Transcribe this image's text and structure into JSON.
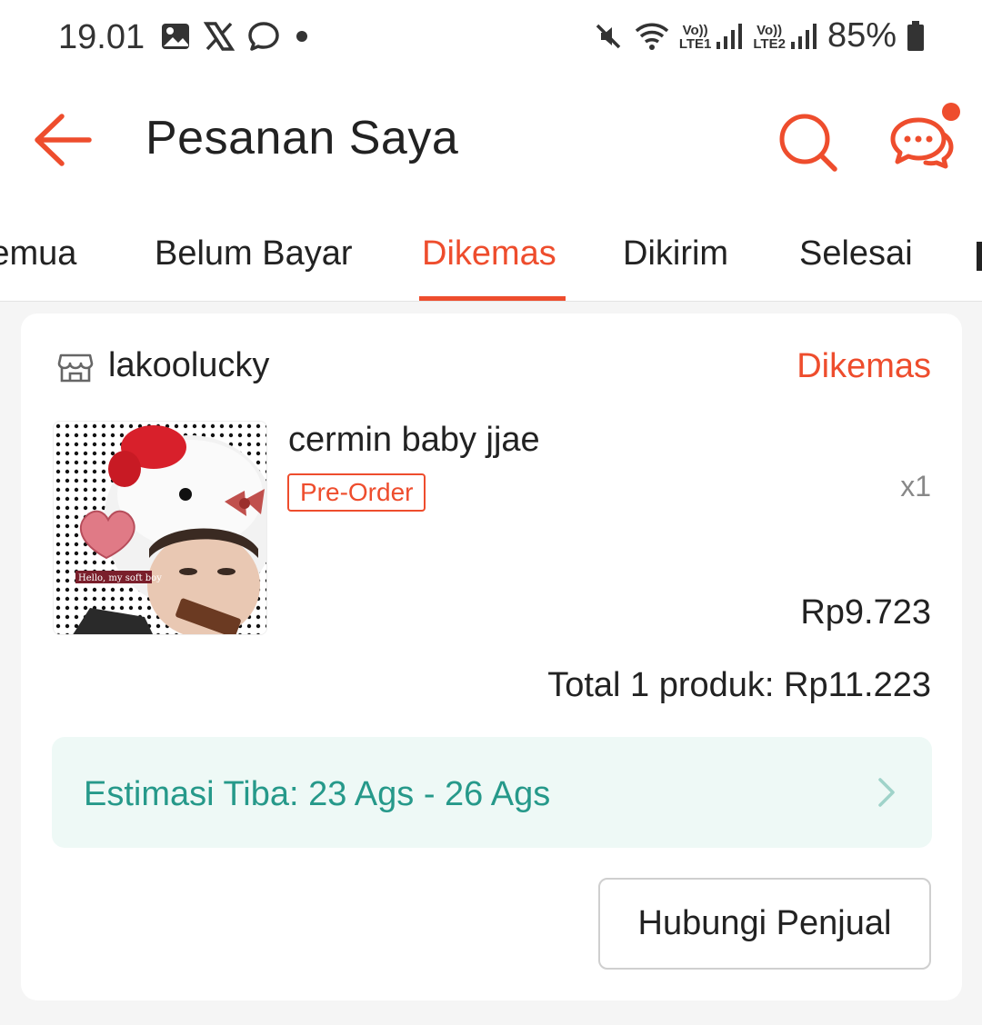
{
  "status_bar": {
    "time": "19.01",
    "battery": "85%",
    "sim1_label_top": "Vo))",
    "sim1_label_bottom": "LTE1",
    "sim2_label_top": "Vo))",
    "sim2_label_bottom": "LTE2"
  },
  "header": {
    "title": "Pesanan Saya",
    "has_unread_chat": true
  },
  "tabs": [
    {
      "label": "Semua",
      "active": false
    },
    {
      "label": "Belum Bayar",
      "active": false
    },
    {
      "label": "Dikemas",
      "active": true
    },
    {
      "label": "Dikirim",
      "active": false
    },
    {
      "label": "Selesai",
      "active": false
    }
  ],
  "order": {
    "shop_name": "lakoolucky",
    "status": "Dikemas",
    "product_name": "cermin baby jjae",
    "badge": "Pre-Order",
    "image_caption": "Hello, my soft boy",
    "quantity": "x1",
    "price": "Rp9.723",
    "total": "Total 1 produk: Rp11.223",
    "eta": "Estimasi Tiba: 23 Ags - 26 Ags",
    "contact_button": "Hubungi Penjual"
  },
  "colors": {
    "accent": "#ee4d2d",
    "eta_text": "#26998a",
    "eta_bg": "#eef9f6"
  }
}
